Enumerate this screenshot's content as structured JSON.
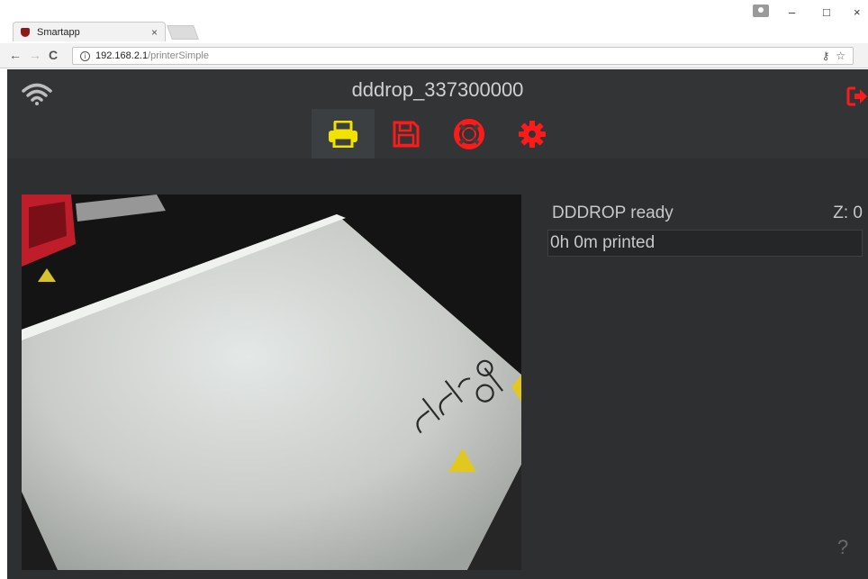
{
  "browser": {
    "tab_title": "Smartapp",
    "tab_close": "×",
    "url_host": "192.168.2.1",
    "url_path": "/printerSimple",
    "window_controls": [
      "–",
      "□",
      "×"
    ],
    "nav": [
      "←",
      "→",
      "C"
    ],
    "omnibox_icons": [
      "key-icon",
      "star-icon"
    ]
  },
  "app": {
    "title": "dddrop_337300000",
    "nav_icons": [
      {
        "name": "print-icon",
        "color": "#f2e200",
        "active": true
      },
      {
        "name": "save-icon",
        "color": "#ff1a1a",
        "active": false
      },
      {
        "name": "lifebuoy-icon",
        "color": "#ff1a1a",
        "active": false
      },
      {
        "name": "gear-icon",
        "color": "#ff1a1a",
        "active": false
      }
    ],
    "status_label": "DDDROP ready",
    "z_label": "Z: 0",
    "progress_text": "0h 0m printed",
    "help_glyph": "?",
    "colors": {
      "accent_red": "#ff1a1a",
      "accent_yellow": "#f2e200",
      "bg": "#2d2f31"
    }
  }
}
